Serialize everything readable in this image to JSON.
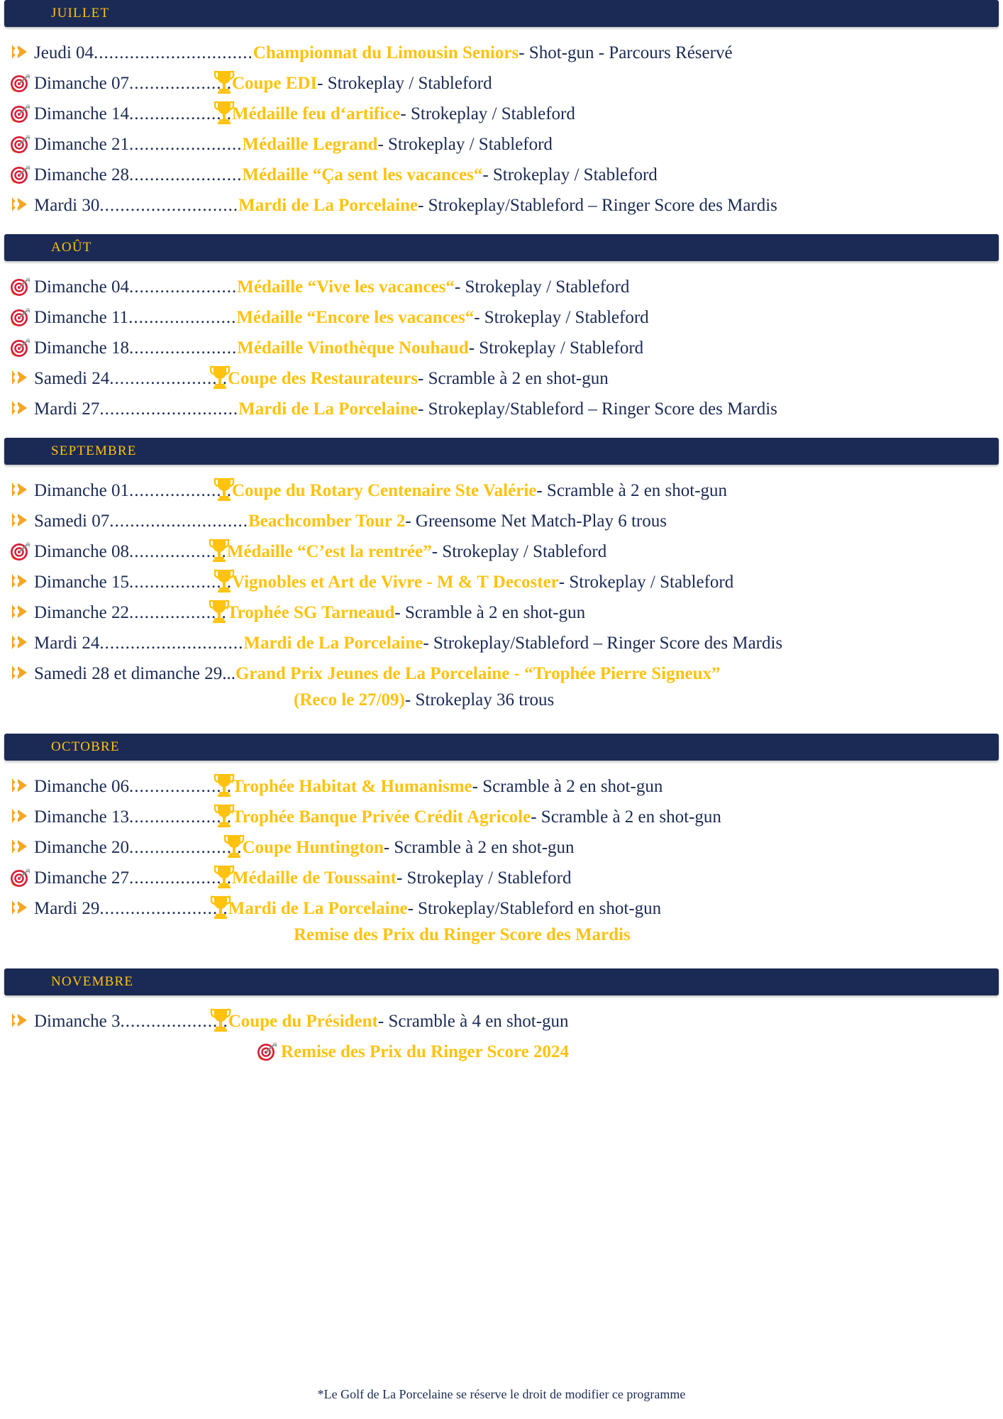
{
  "document": {
    "footer_note": "*Le Golf de La Porcelaine se réserve le droit de modifier ce programme",
    "colors": {
      "banner_bg": "#1b2a54",
      "banner_text": "#ffc20e",
      "title": "#ffc20e",
      "format": "#1b2a54",
      "target_red": "#d81e36",
      "arrow_gold": "#f5a623"
    }
  },
  "months": [
    {
      "name": "JUILLET",
      "events": [
        {
          "bullet": "arrow-bullet-icon",
          "date": "Jeudi 04",
          "leader": "...............................",
          "trophy": false,
          "title": "Championnat du Limousin Seniors",
          "format": " - Shot-gun -  Parcours Réservé"
        },
        {
          "bullet": "target-bullet-icon",
          "date": "Dimanche 07",
          "leader": "....................",
          "trophy": true,
          "title": "Coupe EDI",
          "format": " - Strokeplay / Stableford"
        },
        {
          "bullet": "target-bullet-icon",
          "date": "Dimanche 14",
          "leader": "....................",
          "trophy": true,
          "title": "Médaille  feu d‘artifice ",
          "format": " - Strokeplay / Stableford"
        },
        {
          "bullet": "target-bullet-icon",
          "date": "Dimanche 21",
          "leader": "......................",
          "trophy": false,
          "title": "Médaille Legrand",
          "format": " - Strokeplay / Stableford"
        },
        {
          "bullet": "target-bullet-icon",
          "date": "Dimanche 28",
          "leader": "......................",
          "trophy": false,
          "title": "Médaille  “Ça sent les vacances“",
          "format": " - Strokeplay / Stableford"
        },
        {
          "bullet": "arrow-bullet-icon",
          "date": "Mardi 30",
          "leader": "...........................",
          "trophy": false,
          "title": "Mardi de La Porcelaine ",
          "format": " - Strokeplay/Stableford – Ringer Score des Mardis"
        }
      ]
    },
    {
      "name": "AOÛT",
      "events": [
        {
          "bullet": "target-bullet-icon",
          "date": "Dimanche 04",
          "leader": ".....................",
          "trophy": false,
          "title": "Médaille “Vive les vacances“",
          "format": "- Strokeplay / Stableford"
        },
        {
          "bullet": "target-bullet-icon",
          "date": "Dimanche 11",
          "leader": ".....................",
          "trophy": false,
          "title": "Médaille “Encore les vacances“ ",
          "format": " - Strokeplay / Stableford"
        },
        {
          "bullet": "target-bullet-icon",
          "date": "Dimanche 18",
          "leader": ".....................",
          "trophy": false,
          "title": "Médaille Vinothèque Nouhaud",
          "format": " - Strokeplay / Stableford"
        },
        {
          "bullet": "arrow-bullet-icon",
          "date": "Samedi 24",
          "leader": ".......................",
          "trophy": true,
          "title": "Coupe des Restaurateurs ",
          "format": " - Scramble à 2 en shot-gun"
        },
        {
          "bullet": "arrow-bullet-icon",
          "date": "Mardi 27",
          "leader": "...........................",
          "trophy": false,
          "title": "Mardi de La Porcelaine",
          "format": " - Strokeplay/Stableford – Ringer Score des Mardis"
        }
      ]
    },
    {
      "name": "SEPTEMBRE",
      "events": [
        {
          "bullet": "arrow-bullet-icon",
          "date": "Dimanche 01",
          "leader": "....................",
          "trophy": true,
          "title": "Coupe du Rotary Centenaire Ste Valérie",
          "format": " - Scramble à 2 en shot-gun"
        },
        {
          "bullet": "arrow-bullet-icon",
          "date": "Samedi 07",
          "leader": "...........................",
          "trophy": false,
          "title": " Beachcomber Tour 2",
          "format": " - Greensome Net Match-Play 6 trous"
        },
        {
          "bullet": "target-bullet-icon",
          "date": "Dimanche 08",
          "leader": "...................",
          "trophy": true,
          "title": "Médaille “C’est la rentrée”",
          "format": " - Strokeplay / Stableford"
        },
        {
          "bullet": "arrow-bullet-icon",
          "date": "Dimanche 15",
          "leader": "....................",
          "trophy": true,
          "title": "Vignobles et Art de Vivre - M & T Decoster",
          "format": " -  Strokeplay / Stableford"
        },
        {
          "bullet": "arrow-bullet-icon",
          "date": "Dimanche 22",
          "leader": "...................",
          "trophy": true,
          "title": "Trophée SG Tarneaud",
          "format": " - Scramble à 2 en shot-gun"
        },
        {
          "bullet": "arrow-bullet-icon",
          "date": "Mardi 24",
          "leader": "............................",
          "trophy": false,
          "title": " Mardi de La Porcelaine",
          "format": " - Strokeplay/Stableford – Ringer Score des Mardis"
        },
        {
          "bullet": "arrow-bullet-icon",
          "date": "Samedi 28 et dimanche 29...",
          "leader": "",
          "trophy": false,
          "title": " Grand Prix Jeunes de La Porcelaine   - “Trophée Pierre Signeux”",
          "format": ""
        }
      ],
      "continuation": {
        "title": "(Reco le 27/09)",
        "format": " - Strokeplay 36 trous"
      }
    },
    {
      "name": "OCTOBRE",
      "events": [
        {
          "bullet": "arrow-bullet-icon",
          "date": "Dimanche 06",
          "leader": "....................",
          "trophy": true,
          "title": " Trophée Habitat & Humanisme",
          "format": " - Scramble à 2 en shot-gun"
        },
        {
          "bullet": "arrow-bullet-icon",
          "date": "Dimanche 13",
          "leader": "....................",
          "trophy": true,
          "title": " Trophée  Banque Privée Crédit Agricole",
          "format": " - Scramble à 2 en shot-gun"
        },
        {
          "bullet": "arrow-bullet-icon",
          "date": "Dimanche 20",
          "leader": "......................",
          "trophy": true,
          "title": " Coupe Huntington",
          "format": " - Scramble à 2 en shot-gun"
        },
        {
          "bullet": "target-bullet-icon",
          "date": "Dimanche 27",
          "leader": "....................",
          "trophy": true,
          "title": " Médaille de Toussaint",
          "format": " - Strokeplay / Stableford"
        },
        {
          "bullet": "arrow-bullet-icon",
          "date": "Mardi 29",
          "leader": ".........................",
          "trophy": true,
          "title": " Mardi de La Porcelaine",
          "format": " - Strokeplay/Stableford en shot-gun"
        }
      ],
      "continuation": {
        "title": "Remise des Prix du Ringer Score des Mardis",
        "format": ""
      }
    },
    {
      "name": "NOVEMBRE",
      "events": [
        {
          "bullet": "arrow-bullet-icon",
          "date": "Dimanche 3",
          "leader": ".....................",
          "trophy": true,
          "title": " Coupe du Président",
          "format": " - Scramble à 4 en shot-gun"
        }
      ],
      "continuation_icon": {
        "icon": "target-bullet-icon",
        "title": "Remise des Prix du Ringer Score 2024"
      }
    }
  ]
}
